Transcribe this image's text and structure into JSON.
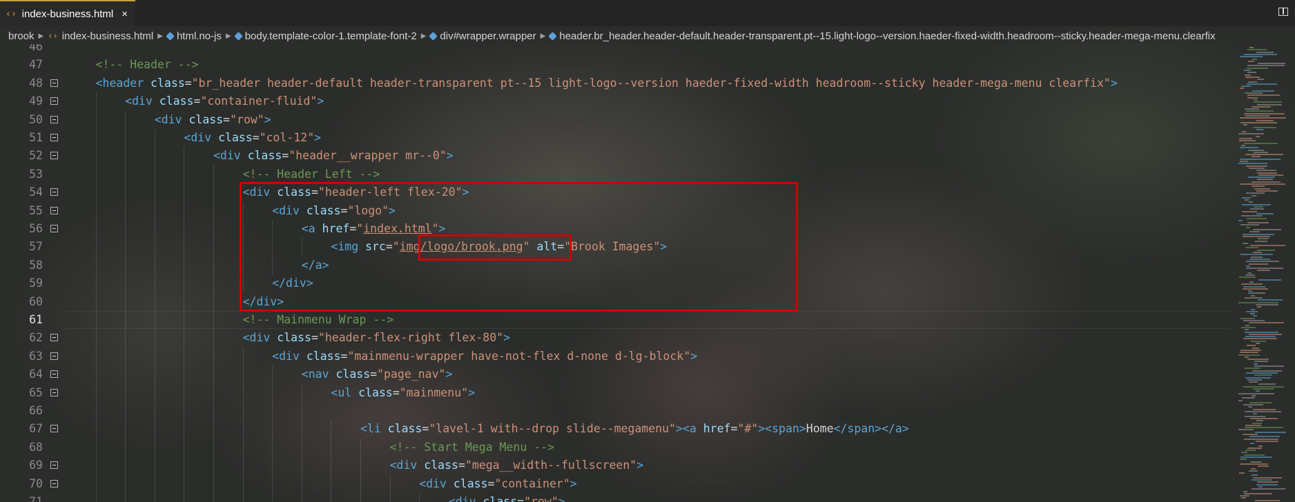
{
  "tab": {
    "icon": "‹›",
    "title": "index-business.html",
    "close": "×"
  },
  "breadcrumb": {
    "items": [
      {
        "label": "brook",
        "icon": ""
      },
      {
        "label": "index-business.html",
        "icon": "html-file-icon"
      },
      {
        "label": "html.no-js",
        "icon": "element-icon"
      },
      {
        "label": "body.template-color-1.template-font-2",
        "icon": "element-icon"
      },
      {
        "label": "div#wrapper.wrapper",
        "icon": "element-icon"
      },
      {
        "label": "header.br_header.header-default.header-transparent.pt--15.light-logo--version.haeder-fixed-width.headroom--sticky.header-mega-menu.clearfix",
        "icon": "element-icon"
      }
    ]
  },
  "colors": {
    "comment": "#6a9955",
    "tag": "#5aa6d6",
    "attribute": "#9cdcfe",
    "string": "#ce9178",
    "highlight_box": "#d00000"
  },
  "editor": {
    "active_line": "61",
    "lines": [
      {
        "n": "46",
        "fold": false,
        "indent": 0,
        "tokens": []
      },
      {
        "n": "47",
        "fold": false,
        "indent": 1,
        "tokens": [
          {
            "t": "c",
            "v": "<!-- Header -->"
          }
        ]
      },
      {
        "n": "48",
        "fold": true,
        "indent": 1,
        "tokens": [
          {
            "t": "g",
            "v": "<"
          },
          {
            "t": "g",
            "v": "header"
          },
          {
            "t": "x",
            "v": " "
          },
          {
            "t": "a",
            "v": "class"
          },
          {
            "t": "x",
            "v": "="
          },
          {
            "t": "s",
            "v": "\"br_header header-default header-transparent pt--15 light-logo--version haeder-fixed-width headroom--sticky header-mega-menu clearfix\""
          },
          {
            "t": "g",
            "v": ">"
          }
        ]
      },
      {
        "n": "49",
        "fold": true,
        "indent": 2,
        "tokens": [
          {
            "t": "g",
            "v": "<div"
          },
          {
            "t": "x",
            "v": " "
          },
          {
            "t": "a",
            "v": "class"
          },
          {
            "t": "x",
            "v": "="
          },
          {
            "t": "s",
            "v": "\"container-fluid\""
          },
          {
            "t": "g",
            "v": ">"
          }
        ]
      },
      {
        "n": "50",
        "fold": true,
        "indent": 3,
        "tokens": [
          {
            "t": "g",
            "v": "<div"
          },
          {
            "t": "x",
            "v": " "
          },
          {
            "t": "a",
            "v": "class"
          },
          {
            "t": "x",
            "v": "="
          },
          {
            "t": "s",
            "v": "\"row\""
          },
          {
            "t": "g",
            "v": ">"
          }
        ]
      },
      {
        "n": "51",
        "fold": true,
        "indent": 4,
        "tokens": [
          {
            "t": "g",
            "v": "<div"
          },
          {
            "t": "x",
            "v": " "
          },
          {
            "t": "a",
            "v": "class"
          },
          {
            "t": "x",
            "v": "="
          },
          {
            "t": "s",
            "v": "\"col-12\""
          },
          {
            "t": "g",
            "v": ">"
          }
        ]
      },
      {
        "n": "52",
        "fold": true,
        "indent": 5,
        "tokens": [
          {
            "t": "g",
            "v": "<div"
          },
          {
            "t": "x",
            "v": " "
          },
          {
            "t": "a",
            "v": "class"
          },
          {
            "t": "x",
            "v": "="
          },
          {
            "t": "s",
            "v": "\"header__wrapper mr--0\""
          },
          {
            "t": "g",
            "v": ">"
          }
        ]
      },
      {
        "n": "53",
        "fold": false,
        "indent": 6,
        "tokens": [
          {
            "t": "c",
            "v": "<!-- Header Left -->"
          }
        ]
      },
      {
        "n": "54",
        "fold": true,
        "indent": 6,
        "tokens": [
          {
            "t": "g",
            "v": "<div"
          },
          {
            "t": "x",
            "v": " "
          },
          {
            "t": "a",
            "v": "class"
          },
          {
            "t": "x",
            "v": "="
          },
          {
            "t": "s",
            "v": "\"header-left flex-20\""
          },
          {
            "t": "g",
            "v": ">"
          }
        ]
      },
      {
        "n": "55",
        "fold": true,
        "indent": 7,
        "tokens": [
          {
            "t": "g",
            "v": "<div"
          },
          {
            "t": "x",
            "v": " "
          },
          {
            "t": "a",
            "v": "class"
          },
          {
            "t": "x",
            "v": "="
          },
          {
            "t": "s",
            "v": "\"logo\""
          },
          {
            "t": "g",
            "v": ">"
          }
        ]
      },
      {
        "n": "56",
        "fold": true,
        "indent": 8,
        "tokens": [
          {
            "t": "g",
            "v": "<a"
          },
          {
            "t": "x",
            "v": " "
          },
          {
            "t": "a",
            "v": "href"
          },
          {
            "t": "x",
            "v": "="
          },
          {
            "t": "s",
            "v": "\""
          },
          {
            "t": "l",
            "v": "index.html"
          },
          {
            "t": "s",
            "v": "\""
          },
          {
            "t": "g",
            "v": ">"
          }
        ]
      },
      {
        "n": "57",
        "fold": false,
        "indent": 9,
        "tokens": [
          {
            "t": "g",
            "v": "<img"
          },
          {
            "t": "x",
            "v": " "
          },
          {
            "t": "a",
            "v": "src"
          },
          {
            "t": "x",
            "v": "="
          },
          {
            "t": "s",
            "v": "\""
          },
          {
            "t": "l",
            "v": "img/logo/brook.png"
          },
          {
            "t": "s",
            "v": "\""
          },
          {
            "t": "x",
            "v": " "
          },
          {
            "t": "a",
            "v": "alt"
          },
          {
            "t": "x",
            "v": "="
          },
          {
            "t": "s",
            "v": "\"Brook Images\""
          },
          {
            "t": "g",
            "v": ">"
          }
        ]
      },
      {
        "n": "58",
        "fold": false,
        "indent": 8,
        "tokens": [
          {
            "t": "g",
            "v": "</a>"
          }
        ]
      },
      {
        "n": "59",
        "fold": false,
        "indent": 7,
        "tokens": [
          {
            "t": "g",
            "v": "</div>"
          }
        ]
      },
      {
        "n": "60",
        "fold": false,
        "indent": 6,
        "tokens": [
          {
            "t": "g",
            "v": "</div>"
          }
        ]
      },
      {
        "n": "61",
        "fold": false,
        "indent": 6,
        "tokens": [
          {
            "t": "c",
            "v": "<!-- Mainmenu Wrap -->"
          }
        ]
      },
      {
        "n": "62",
        "fold": true,
        "indent": 6,
        "tokens": [
          {
            "t": "g",
            "v": "<div"
          },
          {
            "t": "x",
            "v": " "
          },
          {
            "t": "a",
            "v": "class"
          },
          {
            "t": "x",
            "v": "="
          },
          {
            "t": "s",
            "v": "\"header-flex-right flex-80\""
          },
          {
            "t": "g",
            "v": ">"
          }
        ]
      },
      {
        "n": "63",
        "fold": true,
        "indent": 7,
        "tokens": [
          {
            "t": "g",
            "v": "<div"
          },
          {
            "t": "x",
            "v": " "
          },
          {
            "t": "a",
            "v": "class"
          },
          {
            "t": "x",
            "v": "="
          },
          {
            "t": "s",
            "v": "\"mainmenu-wrapper have-not-flex d-none d-lg-block\""
          },
          {
            "t": "g",
            "v": ">"
          }
        ]
      },
      {
        "n": "64",
        "fold": true,
        "indent": 8,
        "tokens": [
          {
            "t": "g",
            "v": "<nav"
          },
          {
            "t": "x",
            "v": " "
          },
          {
            "t": "a",
            "v": "class"
          },
          {
            "t": "x",
            "v": "="
          },
          {
            "t": "s",
            "v": "\"page_nav\""
          },
          {
            "t": "g",
            "v": ">"
          }
        ]
      },
      {
        "n": "65",
        "fold": true,
        "indent": 9,
        "tokens": [
          {
            "t": "g",
            "v": "<ul"
          },
          {
            "t": "x",
            "v": " "
          },
          {
            "t": "a",
            "v": "class"
          },
          {
            "t": "x",
            "v": "="
          },
          {
            "t": "s",
            "v": "\"mainmenu\""
          },
          {
            "t": "g",
            "v": ">"
          }
        ]
      },
      {
        "n": "66",
        "fold": false,
        "indent": 0,
        "tokens": []
      },
      {
        "n": "67",
        "fold": true,
        "indent": 10,
        "tokens": [
          {
            "t": "g",
            "v": "<li"
          },
          {
            "t": "x",
            "v": " "
          },
          {
            "t": "a",
            "v": "class"
          },
          {
            "t": "x",
            "v": "="
          },
          {
            "t": "s",
            "v": "\"lavel-1 with--drop slide--megamenu\""
          },
          {
            "t": "g",
            "v": ">"
          },
          {
            "t": "g",
            "v": "<a"
          },
          {
            "t": "x",
            "v": " "
          },
          {
            "t": "a",
            "v": "href"
          },
          {
            "t": "x",
            "v": "="
          },
          {
            "t": "s",
            "v": "\"#\""
          },
          {
            "t": "g",
            "v": "><span>"
          },
          {
            "t": "x",
            "v": "Home"
          },
          {
            "t": "g",
            "v": "</span></a>"
          }
        ]
      },
      {
        "n": "68",
        "fold": false,
        "indent": 11,
        "tokens": [
          {
            "t": "c",
            "v": "<!-- Start Mega Menu -->"
          }
        ]
      },
      {
        "n": "69",
        "fold": true,
        "indent": 11,
        "tokens": [
          {
            "t": "g",
            "v": "<div"
          },
          {
            "t": "x",
            "v": " "
          },
          {
            "t": "a",
            "v": "class"
          },
          {
            "t": "x",
            "v": "="
          },
          {
            "t": "s",
            "v": "\"mega__width--fullscreen\""
          },
          {
            "t": "g",
            "v": ">"
          }
        ]
      },
      {
        "n": "70",
        "fold": true,
        "indent": 12,
        "tokens": [
          {
            "t": "g",
            "v": "<div"
          },
          {
            "t": "x",
            "v": " "
          },
          {
            "t": "a",
            "v": "class"
          },
          {
            "t": "x",
            "v": "="
          },
          {
            "t": "s",
            "v": "\"container\""
          },
          {
            "t": "g",
            "v": ">"
          }
        ]
      },
      {
        "n": "71",
        "fold": false,
        "indent": 13,
        "tokens": [
          {
            "t": "g",
            "v": "<div"
          },
          {
            "t": "x",
            "v": " "
          },
          {
            "t": "a",
            "v": "class"
          },
          {
            "t": "x",
            "v": "="
          },
          {
            "t": "s",
            "v": "\"row\""
          },
          {
            "t": "g",
            "v": ">"
          }
        ]
      }
    ]
  }
}
